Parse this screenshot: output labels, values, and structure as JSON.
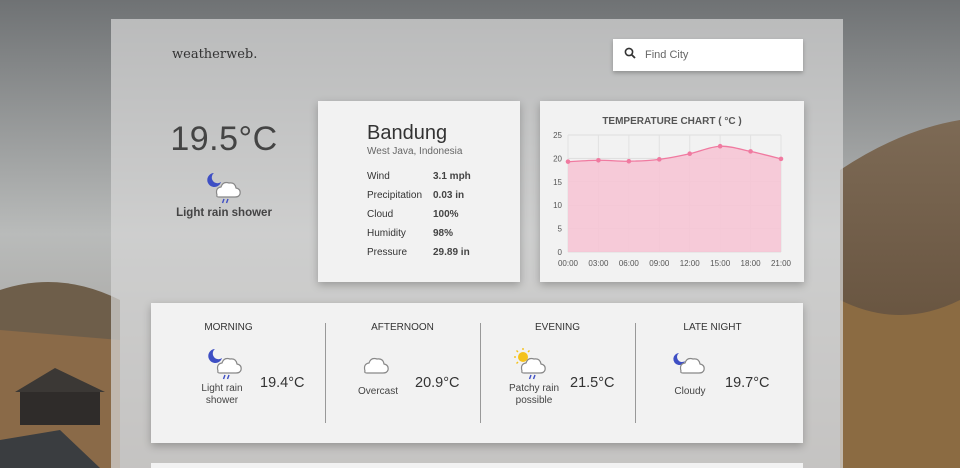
{
  "app": {
    "brand": "weatherweb."
  },
  "search": {
    "placeholder": "Find City",
    "icon": "search-icon"
  },
  "current": {
    "temperature": "19.5°C",
    "condition": "Light rain shower",
    "icon": "moon-rain-cloud-icon"
  },
  "location": {
    "city": "Bandung",
    "region": "West Java, Indonesia",
    "details": [
      {
        "label": "Wind",
        "value": "3.1 mph"
      },
      {
        "label": "Precipitation",
        "value": "0.03 in"
      },
      {
        "label": "Cloud",
        "value": "100%"
      },
      {
        "label": "Humidity",
        "value": "98%"
      },
      {
        "label": "Pressure",
        "value": "29.89 in"
      }
    ]
  },
  "chart_data": {
    "type": "area",
    "title": "TEMPERATURE CHART ( °C )",
    "categories": [
      "00:00",
      "03:00",
      "06:00",
      "09:00",
      "12:00",
      "15:00",
      "18:00",
      "21:00"
    ],
    "values": [
      19.3,
      19.6,
      19.4,
      19.8,
      21.0,
      22.6,
      21.5,
      19.9
    ],
    "ylim": [
      0,
      25
    ],
    "yticks": [
      "0",
      "5",
      "10",
      "15",
      "20",
      "25"
    ],
    "grid": true,
    "colors": {
      "line": "#f07aa0",
      "fill": "#f7c3d3"
    }
  },
  "forecast": [
    {
      "period": "MORNING",
      "condition": "Light rain shower",
      "temperature": "19.4°C",
      "icon": "moon-rain-cloud-icon"
    },
    {
      "period": "AFTERNOON",
      "condition": "Overcast",
      "temperature": "20.9°C",
      "icon": "cloud-icon"
    },
    {
      "period": "EVENING",
      "condition": "Patchy rain possible",
      "temperature": "21.5°C",
      "icon": "sun-rain-cloud-icon"
    },
    {
      "period": "LATE NIGHT",
      "condition": "Cloudy",
      "temperature": "19.7°C",
      "icon": "moon-cloud-icon"
    }
  ]
}
